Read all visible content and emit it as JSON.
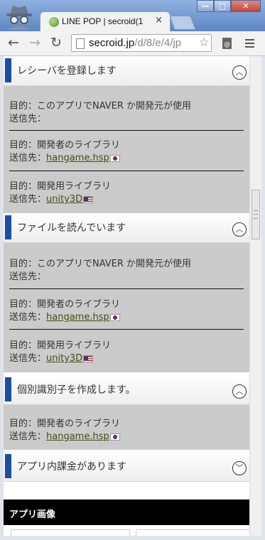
{
  "browser": {
    "tab_title": "LINE POP | secroid(1",
    "tab_close": "×",
    "window_buttons": {
      "minimize": "—",
      "maximize": "□",
      "close": "✕"
    },
    "url_host": "secroid.jp",
    "url_path": "/d/8/e/4/jp"
  },
  "sections": [
    {
      "title": "レシーバを登録します",
      "toggle": "︿",
      "entries": [
        {
          "purpose": "目的：このアプリでNAVER か開発元が使用",
          "dest_label": "送信先：",
          "dest": "",
          "flag": ""
        },
        {
          "purpose": "目的：開発者のライブラリ",
          "dest_label": "送信先：",
          "dest": "hangame.hsp",
          "flag": "kr"
        },
        {
          "purpose": "目的：開発用ライブラリ",
          "dest_label": "送信先：",
          "dest": "unity3D",
          "flag": "us"
        }
      ]
    },
    {
      "title": "ファイルを読んでいます",
      "toggle": "︿",
      "entries": [
        {
          "purpose": "目的：このアプリでNAVER か開発元が使用",
          "dest_label": "送信先：",
          "dest": "",
          "flag": ""
        },
        {
          "purpose": "目的：開発者のライブラリ",
          "dest_label": "送信先：",
          "dest": "hangame.hsp",
          "flag": "kr"
        },
        {
          "purpose": "目的：開発用ライブラリ",
          "dest_label": "送信先：",
          "dest": "unity3D",
          "flag": "us"
        }
      ]
    },
    {
      "title": "個別識別子を作成します。",
      "toggle": "︿",
      "entries": [
        {
          "purpose": "目的：開発者のライブラリ",
          "dest_label": "送信先：",
          "dest": "hangame.hsp",
          "flag": "kr"
        }
      ]
    },
    {
      "title": "アプリ内課金があります",
      "toggle": "﹀",
      "entries": []
    }
  ],
  "app_images_label": "アプリ画像",
  "colors": {
    "accent": "#1a4fa0",
    "section_bg": "#cbcbcb",
    "link": "#4a4a18"
  }
}
